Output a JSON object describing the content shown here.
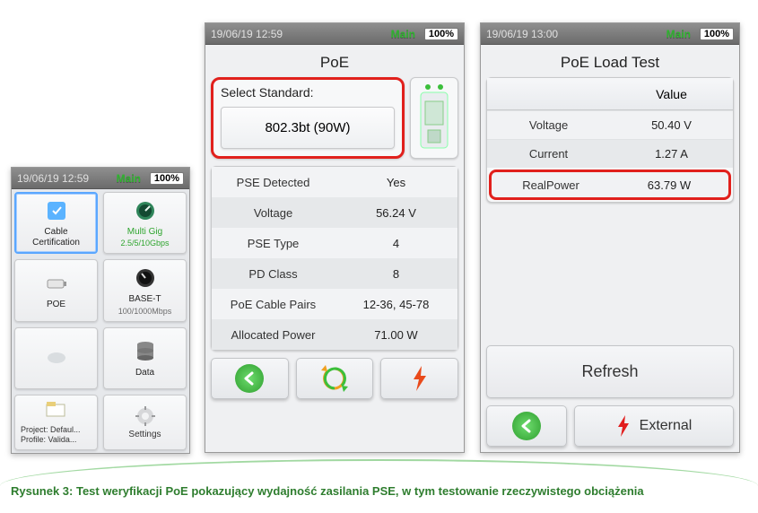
{
  "caption": "Rysunek 3: Test weryfikacji PoE pokazujący wydajność zasilania PSE, w tym testowanie rzeczywistego obciążenia",
  "d1": {
    "datetime": "19/06/19 12:59",
    "main_label": "Main",
    "battery": "100%",
    "tiles": [
      {
        "name": "cable-cert",
        "label": "Cable\nCertification",
        "sub": ""
      },
      {
        "name": "multi-gig",
        "label": "Multi Gig",
        "sub": "2.5/5/10Gbps",
        "green": true
      },
      {
        "name": "poe",
        "label": "POE",
        "sub": ""
      },
      {
        "name": "base-t",
        "label": "BASE-T",
        "sub": "100/1000Mbps"
      },
      {
        "name": "blank",
        "label": "",
        "sub": ""
      },
      {
        "name": "data",
        "label": "Data",
        "sub": ""
      }
    ],
    "footer": {
      "project": "Project: Defaul...\nProfile: Valida...",
      "settings": "Settings"
    }
  },
  "d2": {
    "datetime": "19/06/19 12:59",
    "main_label": "Main",
    "battery": "100%",
    "title": "PoE",
    "select_label": "Select Standard:",
    "select_value": "802.3bt (90W)",
    "rows": [
      {
        "k": "PSE Detected",
        "v": "Yes"
      },
      {
        "k": "Voltage",
        "v": "56.24 V"
      },
      {
        "k": "PSE Type",
        "v": "4"
      },
      {
        "k": "PD Class",
        "v": "8"
      },
      {
        "k": "PoE Cable Pairs",
        "v": "12-36, 45-78"
      },
      {
        "k": "Allocated Power",
        "v": "71.00 W"
      }
    ],
    "icons": {
      "back": "back-icon",
      "refresh": "refresh-icon",
      "bolt": "bolt-icon"
    }
  },
  "d3": {
    "datetime": "19/06/19 13:00",
    "main_label": "Main",
    "battery": "100%",
    "title": "PoE Load Test",
    "header_value": "Value",
    "rows": [
      {
        "k": "Voltage",
        "v": "50.40 V"
      },
      {
        "k": "Current",
        "v": "1.27 A"
      },
      {
        "k": "RealPower",
        "v": "63.79 W",
        "highlight": true
      }
    ],
    "refresh_label": "Refresh",
    "external_label": "External",
    "icons": {
      "back": "back-icon",
      "bolt": "bolt-icon"
    }
  }
}
